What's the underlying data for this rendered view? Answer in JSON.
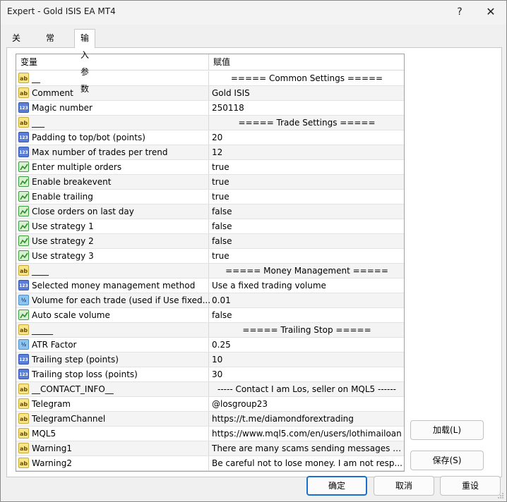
{
  "window": {
    "title": "Expert - Gold ISIS EA MT4",
    "help_glyph": "?",
    "close_glyph": "✕"
  },
  "tabs": [
    {
      "label": "关于"
    },
    {
      "label": "常用"
    },
    {
      "label": "输入参数"
    }
  ],
  "grid": {
    "headers": {
      "variable": "变量",
      "value": "赋值"
    },
    "rows": [
      {
        "type": "ab",
        "name": "__",
        "value": "===== Common Settings ====="
      },
      {
        "type": "ab",
        "name": "Comment",
        "value": "Gold ISIS"
      },
      {
        "type": "123",
        "name": "Magic number",
        "value": "250118"
      },
      {
        "type": "ab",
        "name": "___",
        "value": "===== Trade Settings ====="
      },
      {
        "type": "123",
        "name": "Padding to top/bot (points)",
        "value": "20"
      },
      {
        "type": "123",
        "name": "Max number of trades per trend",
        "value": "12"
      },
      {
        "type": "bool",
        "name": "Enter multiple orders",
        "value": "true"
      },
      {
        "type": "bool",
        "name": "Enable breakevent",
        "value": "true"
      },
      {
        "type": "bool",
        "name": "Enable trailing",
        "value": "true"
      },
      {
        "type": "bool",
        "name": "Close orders on last day",
        "value": "false"
      },
      {
        "type": "bool",
        "name": "Use strategy 1",
        "value": "false"
      },
      {
        "type": "bool",
        "name": "Use strategy 2",
        "value": "false"
      },
      {
        "type": "bool",
        "name": "Use strategy 3",
        "value": "true"
      },
      {
        "type": "ab",
        "name": "____",
        "value": "===== Money Management ====="
      },
      {
        "type": "123",
        "name": "Selected money management method",
        "value": "Use a fixed trading volume"
      },
      {
        "type": "half",
        "name": "Volume for each trade (used if Use fixed...",
        "value": "0.01"
      },
      {
        "type": "bool",
        "name": "Auto scale volume",
        "value": "false"
      },
      {
        "type": "ab",
        "name": "_____",
        "value": "===== Trailing Stop ====="
      },
      {
        "type": "half",
        "name": "ATR Factor",
        "value": "0.25"
      },
      {
        "type": "123",
        "name": "Trailing step (points)",
        "value": "10"
      },
      {
        "type": "123",
        "name": "Trailing stop loss (points)",
        "value": "30"
      },
      {
        "type": "ab",
        "name": "__CONTACT_INFO__",
        "value": "----- Contact I am Los, seller on MQL5 ------"
      },
      {
        "type": "ab",
        "name": "Telegram",
        "value": "@losgroup23"
      },
      {
        "type": "ab",
        "name": "TelegramChannel",
        "value": "https://t.me/diamondforextrading"
      },
      {
        "type": "ab",
        "name": "MQL5",
        "value": "https://www.mql5.com/en/users/lothimailoan"
      },
      {
        "type": "ab",
        "name": "Warning1",
        "value": "There are many scams sending messages a..."
      },
      {
        "type": "ab",
        "name": "Warning2",
        "value": "Be careful not to lose money. I am not resp..."
      }
    ]
  },
  "icons": {
    "ab": "ab",
    "123": "123",
    "half": "½"
  },
  "buttons": {
    "load": "加载(L)",
    "save": "保存(S)",
    "ok": "确定",
    "cancel": "取消",
    "reset": "重设"
  }
}
